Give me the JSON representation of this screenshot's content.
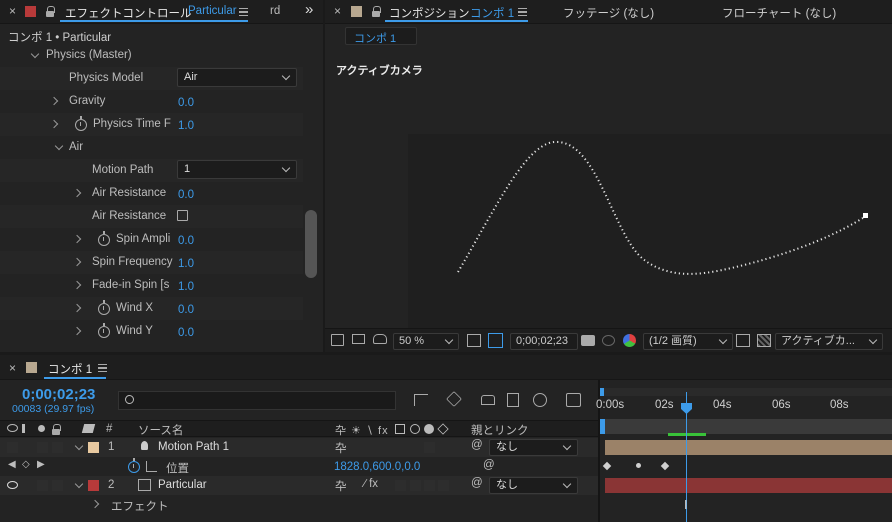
{
  "effects_panel": {
    "tab_title": "エフェクトコントロール",
    "tab_effect": "Particular",
    "tab_overflow": "rd",
    "more_glyph": "»",
    "breadcrumb": "コンポ 1 • Particular",
    "group_label": "Physics (Master)",
    "rows": [
      {
        "label": "Physics Model",
        "value": "Air"
      },
      {
        "label": "Gravity",
        "value": "0.0"
      },
      {
        "label": "Physics Time F",
        "value": "1.0"
      },
      {
        "label": "Air",
        "value": ""
      },
      {
        "label": "Motion Path",
        "value": "1"
      },
      {
        "label": "Air Resistance",
        "value": "0.0"
      },
      {
        "label": "Air Resistance",
        "value": ""
      },
      {
        "label": "Spin Ampli",
        "value": "0.0"
      },
      {
        "label": "Spin Frequency",
        "value": "1.0"
      },
      {
        "label": "Fade-in Spin [s",
        "value": "1.0"
      },
      {
        "label": "Wind X",
        "value": "0.0"
      },
      {
        "label": "Wind Y",
        "value": "0.0"
      }
    ]
  },
  "comp_panel": {
    "tab_title": "コンポジション",
    "tab_comp": "コンポ 1",
    "tab_footage": "フッテージ (なし)",
    "tab_flowchart": "フローチャート (なし)",
    "comp_chip": "コンポ 1",
    "camera_label": "アクティブカメラ",
    "zoom": "50 %",
    "timecode": "0;00;02;23",
    "resolution": "(1/2 画質)",
    "camera_select": "アクティブカ..."
  },
  "timeline": {
    "tab_title": "コンポ 1",
    "timecode": "0;00;02;23",
    "frame_info": "00083 (29.97 fps)",
    "search_placeholder": "",
    "header": {
      "hash": "#",
      "source_name": "ソース名",
      "parent_link": "親とリンク"
    },
    "layers": [
      {
        "index": "1",
        "name": "Motion Path 1",
        "parent": "なし"
      },
      {
        "index": "2",
        "name": "Particular",
        "parent": "なし"
      }
    ],
    "position_label": "位置",
    "position_value": "1828.0,600.0,0.0",
    "effect_label": "エフェクト",
    "ruler": [
      "0:00s",
      "02s",
      "04s",
      "06s",
      "08s"
    ]
  },
  "colors": {
    "accent_blue": "#3d9be9",
    "layer1_color": "#e8c9a0",
    "layer2_color": "#b83a3a",
    "layer1_bar": "#9b8268",
    "layer2_bar": "#8a3535",
    "work_area_green": "#39c239"
  }
}
